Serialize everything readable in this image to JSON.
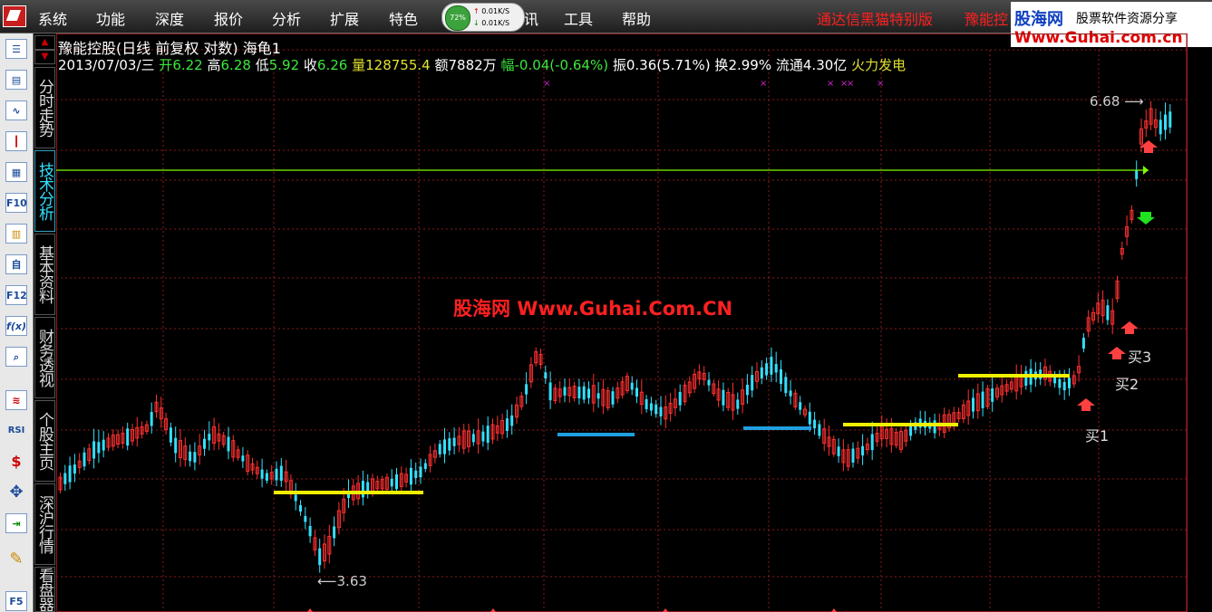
{
  "menu": {
    "items": [
      "系统",
      "功能",
      "深度",
      "报价",
      "分析",
      "扩展",
      "特色",
      "讯",
      "工具",
      "帮助"
    ],
    "promo_title": "通达信黑猫特别版",
    "promo_stock": "豫能控",
    "net": {
      "percent": "72%",
      "up": "0.01K/S",
      "down": "0.01K/S"
    },
    "brand": {
      "name": "股海网",
      "slogan": "股票软件资源分享",
      "url": "Www.Guhai.com.cn"
    }
  },
  "toolbar": {
    "buttons": [
      "",
      "",
      "",
      "",
      "",
      "F10",
      "",
      "自",
      "F12",
      "f(x)",
      "",
      "",
      "RSI",
      "$",
      "",
      "",
      "",
      "F5"
    ]
  },
  "tabs": [
    "分时走势",
    "技术分析",
    "基本资料",
    "财务透视",
    "个股主页",
    "深沪行情",
    "看盘器"
  ],
  "chart": {
    "title": "豫能控股(日线 前复权 对数) 海龟1",
    "info": {
      "date": "2013/07/03/三",
      "open_label": "开",
      "open": "6.22",
      "high_label": "高",
      "high": "6.28",
      "low_label": "低",
      "low": "5.92",
      "close_label": "收",
      "close": "6.26",
      "vol_label": "量",
      "vol": "128755.4",
      "amount_label": "额",
      "amount": "7882万",
      "change_label": "幅",
      "change": "-0.04(-0.64%)",
      "amp_label": "振",
      "amp": "0.36(5.71%)",
      "turnover_label": "换",
      "turnover": "2.99%",
      "float_label": "流通",
      "float": "4.30亿",
      "sector": "火力发电"
    },
    "watermark": "股海网 Www.Guhai.Com.CN",
    "high_mark": "6.68",
    "low_mark": "3.63",
    "signals": [
      "买1",
      "买2",
      "买3"
    ],
    "colors": {
      "up": "#ff3030",
      "down": "#33e0ff",
      "grid": "#8b1a1a",
      "level": "#f0f000",
      "level2": "#1fa0e0",
      "ref": "#7cfc00"
    }
  }
}
